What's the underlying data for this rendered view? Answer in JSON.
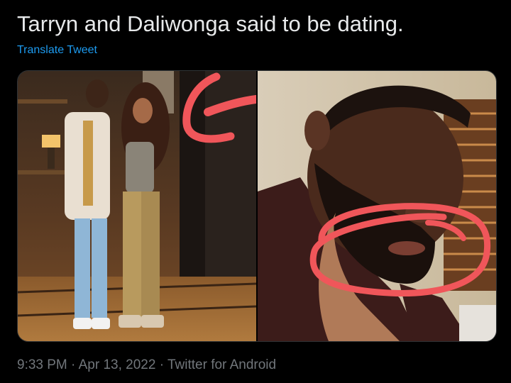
{
  "tweet": {
    "text": "Tarryn and Daliwonga said to be dating.",
    "translate_label": "Translate Tweet"
  },
  "media": {
    "photos": [
      {
        "icon": "photo-couple-standing"
      },
      {
        "icon": "photo-man-closeup-annotated"
      }
    ],
    "annotation_color": "#f0565a"
  },
  "meta": {
    "time": "9:33 PM",
    "separator": "·",
    "date": "Apr 13, 2022",
    "source": "Twitter for Android"
  },
  "colors": {
    "background": "#000000",
    "text": "#e7e9ea",
    "link": "#1d9bf0",
    "muted": "#71767b"
  }
}
